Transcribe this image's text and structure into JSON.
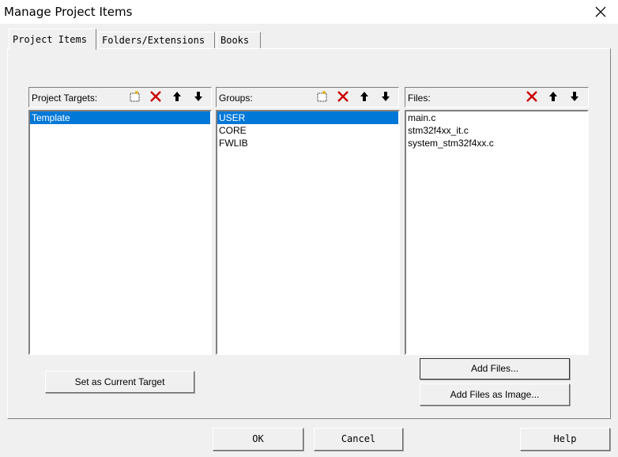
{
  "window": {
    "title": "Manage Project Items",
    "close_icon": "×"
  },
  "tabs": [
    {
      "label": "Project Items",
      "active": true
    },
    {
      "label": "Folders/Extensions",
      "active": false
    },
    {
      "label": "Books",
      "active": false
    }
  ],
  "targets": {
    "label": "Project Targets:",
    "items": [
      "Template"
    ],
    "selected": "Template",
    "set_current_button": "Set as Current Target"
  },
  "groups": {
    "label": "Groups:",
    "items": [
      "USER",
      "CORE",
      "FWLIB"
    ],
    "selected": "USER"
  },
  "files": {
    "label": "Files:",
    "items": [
      "main.c",
      "stm32f4xx_it.c",
      "system_stm32f4xx.c"
    ],
    "add_files_button": "Add Files...",
    "add_files_image_button": "Add Files as Image..."
  },
  "toolbar_icons": {
    "new": "new-item-icon",
    "delete": "delete-icon",
    "up": "move-up-icon",
    "down": "move-down-icon",
    "delete_color": "#cc0000"
  },
  "buttons": {
    "ok": "OK",
    "cancel": "Cancel",
    "help": "Help"
  },
  "colors": {
    "selection": "#0078d7",
    "dialog_bg": "#f0f0f0"
  }
}
